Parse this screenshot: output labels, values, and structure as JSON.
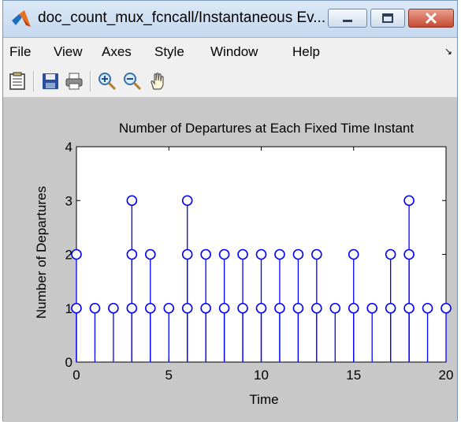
{
  "window": {
    "title": "doc_count_mux_fcncall/Instantaneous Ev..."
  },
  "menu": {
    "items": [
      "File",
      "View",
      "Axes",
      "Style",
      "Window",
      "Help"
    ]
  },
  "toolbar": {
    "icons": [
      "properties-icon",
      "save-icon",
      "print-icon",
      "zoom-in-icon",
      "zoom-out-icon",
      "pan-icon"
    ]
  },
  "colors": {
    "stem": "#0000ff",
    "figure_bg": "#c8c8c8",
    "axes_bg": "#ffffff"
  },
  "chart_data": {
    "type": "stem",
    "title": "Number of Departures at Each Fixed Time Instant",
    "xlabel": "Time",
    "ylabel": "Number of Departures",
    "xlim": [
      0,
      20
    ],
    "ylim": [
      0,
      4
    ],
    "xticks": [
      0,
      5,
      10,
      15,
      20
    ],
    "yticks": [
      0,
      1,
      2,
      3,
      4
    ],
    "grid": false,
    "series": [
      {
        "x": [
          0,
          0,
          1,
          2,
          3,
          3,
          3,
          4,
          4,
          5,
          6,
          6,
          6,
          7,
          7,
          8,
          8,
          9,
          9,
          10,
          10,
          11,
          11,
          12,
          12,
          13,
          13,
          14,
          15,
          15,
          16,
          17,
          17,
          18,
          18,
          18,
          19,
          20
        ],
        "y": [
          1,
          2,
          1,
          1,
          1,
          2,
          3,
          1,
          2,
          1,
          1,
          2,
          3,
          1,
          2,
          1,
          2,
          1,
          2,
          1,
          2,
          1,
          2,
          1,
          2,
          1,
          2,
          1,
          1,
          2,
          1,
          1,
          2,
          1,
          2,
          3,
          1,
          1
        ]
      }
    ]
  }
}
